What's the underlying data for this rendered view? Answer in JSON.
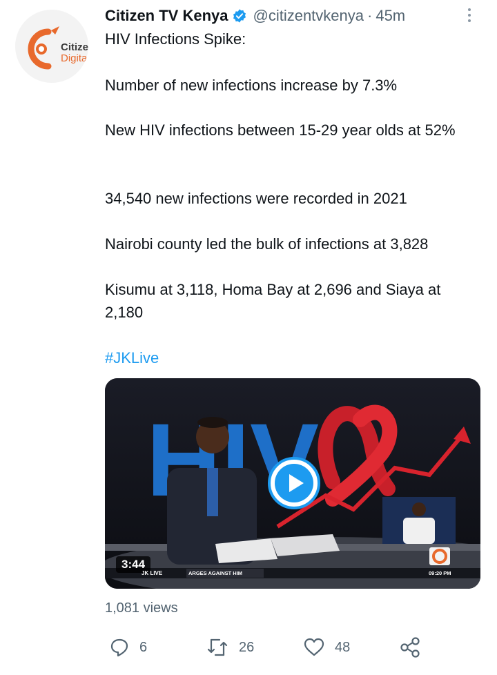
{
  "author": {
    "name": "Citizen TV Kenya",
    "handle": "@citizentvkenya",
    "separator": "·",
    "time": "45m",
    "avatar_brand_line1": "Citizen",
    "avatar_brand_line2": "Digital"
  },
  "tweet": {
    "title_line": "HIV Infections Spike:",
    "lines": [
      "Number of new infections increase by 7.3%",
      "New HIV infections between 15-29 year olds at 52%",
      "34,540 new infections were recorded in 2021",
      "Nairobi county led the bulk of infections at 3,828",
      "Kisumu at 3,118, Homa Bay at 2,696 and Siaya at 2,180"
    ],
    "hashtag": "#JKLive"
  },
  "video": {
    "duration": "3:44",
    "graphic_text": "HIV",
    "ticker_left": "JK LIVE",
    "ticker_main": "ARGES AGAINST HIM",
    "ticker_time": "09:20 PM"
  },
  "stats": {
    "views": "1,081 views",
    "replies": "6",
    "retweets": "26",
    "likes": "48"
  },
  "colors": {
    "accent": "#1d9bf0",
    "secondary_text": "#536471",
    "brand_orange": "#e8692c"
  },
  "icons": [
    "verified-badge-icon",
    "more-options-icon",
    "play-icon",
    "reply-icon",
    "retweet-icon",
    "like-icon",
    "share-icon"
  ]
}
